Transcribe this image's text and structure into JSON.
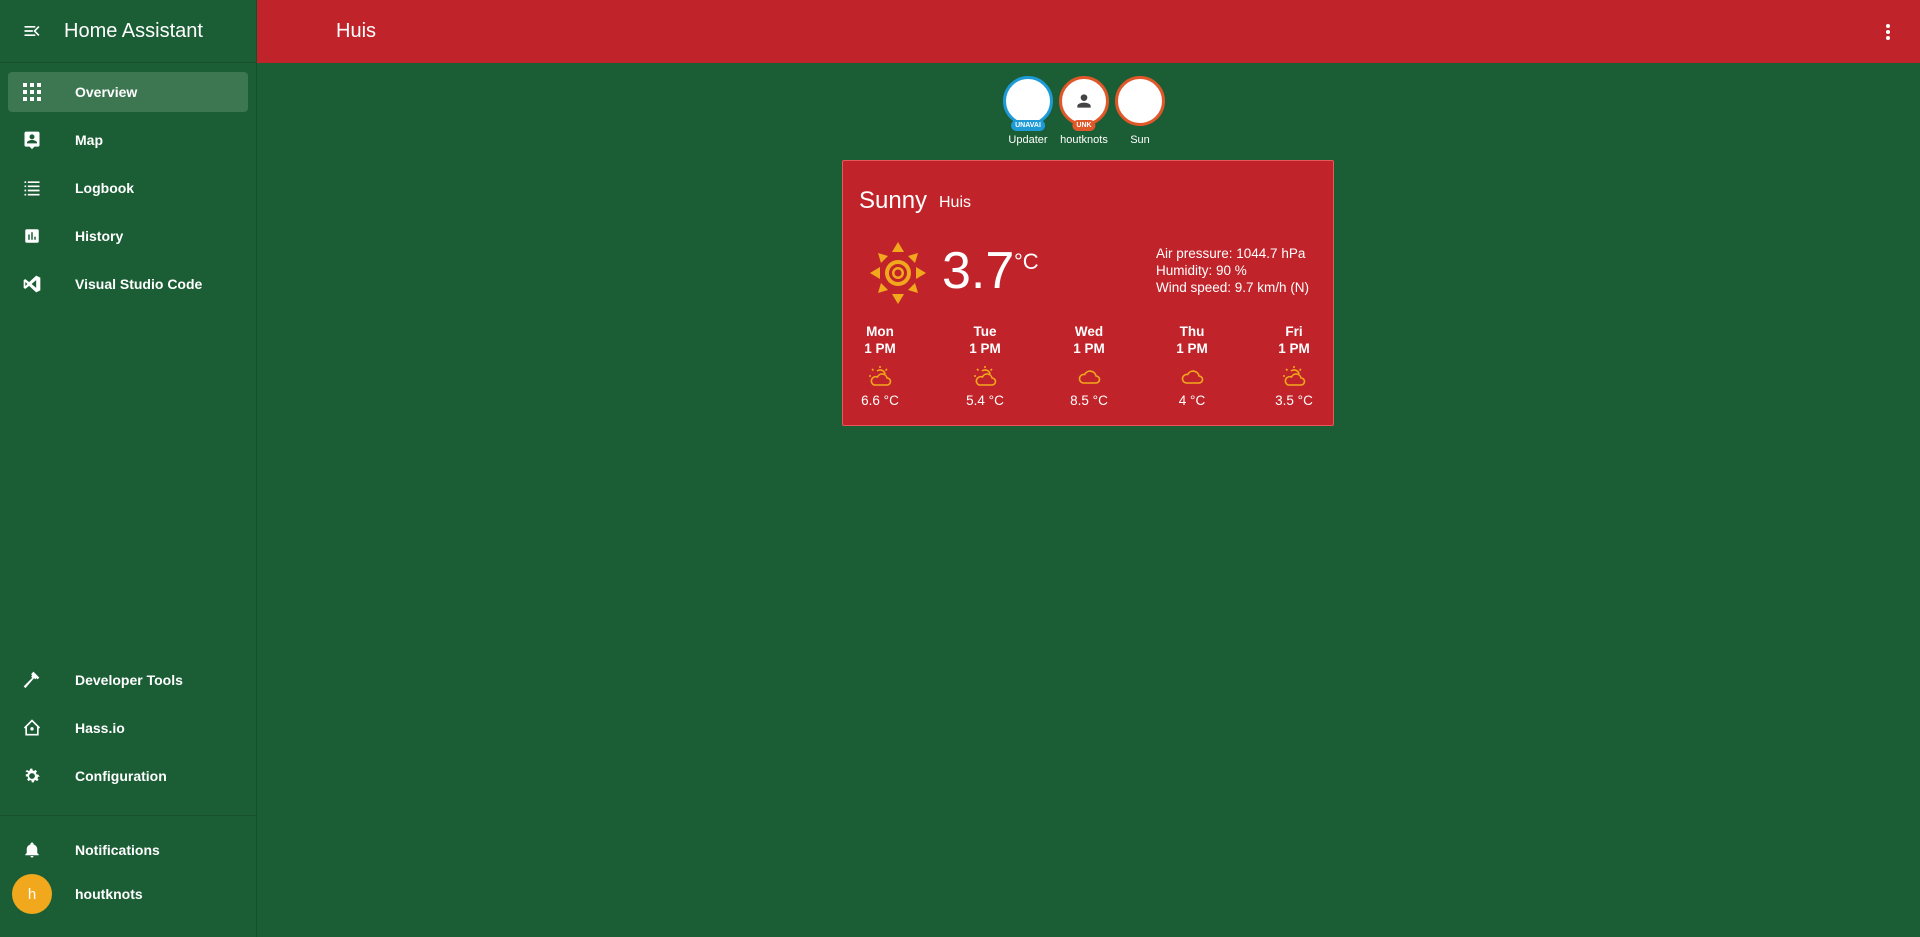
{
  "sidebar": {
    "title": "Home Assistant",
    "items": [
      {
        "label": "Overview",
        "icon": "grid-icon",
        "active": true
      },
      {
        "label": "Map",
        "icon": "map-account-icon"
      },
      {
        "label": "Logbook",
        "icon": "list-icon"
      },
      {
        "label": "History",
        "icon": "chart-bar-icon"
      },
      {
        "label": "Visual Studio Code",
        "icon": "vscode-icon"
      }
    ],
    "bottom_items": [
      {
        "label": "Developer Tools",
        "icon": "hammer-icon"
      },
      {
        "label": "Hass.io",
        "icon": "home-assistant-icon"
      },
      {
        "label": "Configuration",
        "icon": "gear-icon"
      }
    ],
    "notifications_label": "Notifications",
    "user": {
      "initial": "h",
      "name": "houtknots"
    }
  },
  "header": {
    "title": "Huis"
  },
  "badges": [
    {
      "name": "Updater",
      "tag": "UNAVAI",
      "icon": "blank"
    },
    {
      "name": "houtknots",
      "tag": "UNK",
      "icon": "account-icon"
    },
    {
      "name": "Sun",
      "tag": "",
      "icon": "moon-icon"
    }
  ],
  "weather": {
    "condition": "Sunny",
    "location": "Huis",
    "temperature": "3.7",
    "unit": "°C",
    "attributes": {
      "pressure": "Air pressure: 1044.7 hPa",
      "humidity": "Humidity: 90 %",
      "wind": "Wind speed: 9.7 km/h (N)"
    },
    "forecast": [
      {
        "day": "Mon",
        "time": "1 PM",
        "icon": "partly-sunny-icon",
        "temp": "6.6 °C"
      },
      {
        "day": "Tue",
        "time": "1 PM",
        "icon": "partly-sunny-icon",
        "temp": "5.4 °C"
      },
      {
        "day": "Wed",
        "time": "1 PM",
        "icon": "cloud-icon",
        "temp": "8.5 °C"
      },
      {
        "day": "Thu",
        "time": "1 PM",
        "icon": "cloud-icon",
        "temp": "4 °C"
      },
      {
        "day": "Fri",
        "time": "1 PM",
        "icon": "partly-sunny-icon",
        "temp": "3.5 °C"
      }
    ]
  },
  "colors": {
    "background": "#1b5e35",
    "header": "#c0242a",
    "card": "#c0242a",
    "accent_orange": "#e0572a",
    "accent_blue": "#1e9ad6",
    "sun_yellow": "#f2a81d"
  }
}
